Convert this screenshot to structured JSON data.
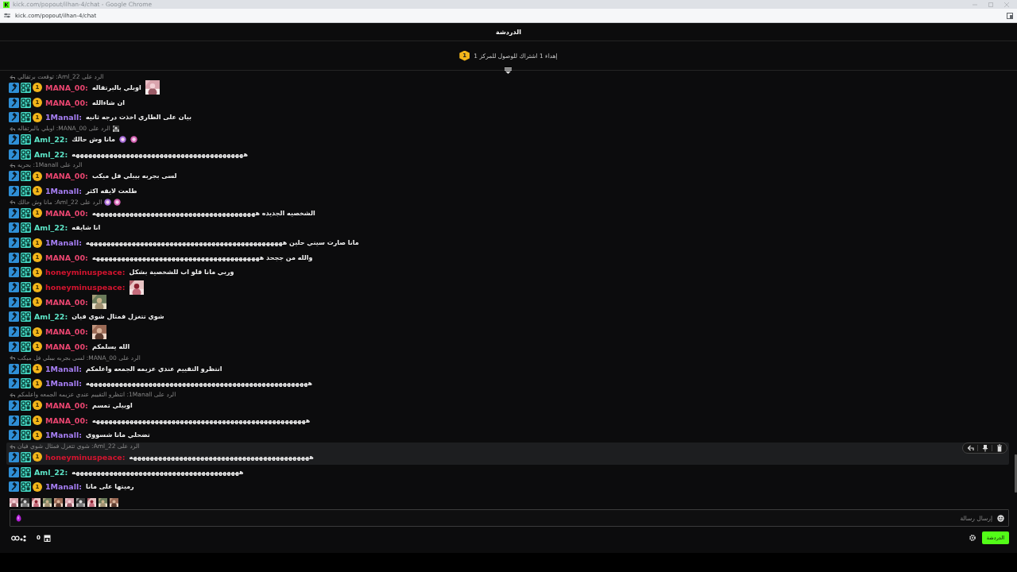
{
  "browser": {
    "title": "kick.com/popout/ilhan-4/chat - Google Chrome",
    "url": "kick.com/popout/ilhan-4/chat"
  },
  "chat": {
    "title": "الدردشة",
    "pinned": {
      "badge": "1",
      "text": "إهداء 1 اشتراك للوصول للمركز 1"
    },
    "messages": [
      {
        "reply": {
          "text": "الرد على Aml_22: توقعت برتقالي"
        },
        "user": "MANA_00:",
        "color": "#e8456f",
        "sub_badge": "1",
        "text": "اوبلي بالبرتقاله",
        "highlighted": false
      },
      {
        "user": "MANA_00:",
        "color": "#e8456f",
        "sub_badge": "1",
        "text": "ان شاءالله",
        "highlighted": false
      },
      {
        "user": "1Manall:",
        "color": "#a77ff5",
        "sub_badge": "1",
        "text": "بيان على الطاري اخذت درجه ثانيه",
        "highlighted": false
      },
      {
        "reply": {
          "text": "الرد على MANA_00: اوبلي بالبرتقاله"
        },
        "user": "Aml_22:",
        "color": "#5de3c6",
        "text": "مانا وش حالك",
        "emojis": [
          {
            "kind": "emoji"
          },
          {
            "kind": "emoji"
          }
        ],
        "highlighted": false
      },
      {
        "user": "Aml_22:",
        "color": "#5de3c6",
        "text": "هههههههههههههههههههههههههههههههههههههههههه",
        "highlighted": false
      },
      {
        "reply": {
          "text": "الرد على 1Manall: بحريه"
        },
        "user": "MANA_00:",
        "color": "#e8456f",
        "sub_badge": "1",
        "text": "لسى بجربه بيبلي فل ميكب",
        "highlighted": false
      },
      {
        "user": "1Manall:",
        "color": "#a77ff5",
        "sub_badge": "1",
        "text": "طلعت لايقه اكثر",
        "highlighted": false
      },
      {
        "reply": {
          "text": "الرد على Aml_22: مانا وش حالك",
          "emojis": [
            {
              "kind": "emoji"
            },
            {
              "kind": "emoji"
            }
          ]
        },
        "user": "MANA_00:",
        "color": "#e8456f",
        "sub_badge": "1",
        "text": "الشخصيه الجديده هههههههههههههههههههههههههههههههههههههههه",
        "highlighted": false
      },
      {
        "user": "Aml_22:",
        "color": "#5de3c6",
        "text": "انا شايفه",
        "highlighted": false
      },
      {
        "user": "1Manall:",
        "color": "#a77ff5",
        "sub_badge": "1",
        "text": "مانا صارت سيني حلين هههههههههههههههههههههههههههههههههههههههههههههههه",
        "highlighted": false
      },
      {
        "user": "MANA_00:",
        "color": "#e8456f",
        "sub_badge": "1",
        "text": "والله من ججحد ههههههههههههههههههههههههههههههههههههههههه",
        "highlighted": false
      },
      {
        "user": "honeyminuspeace:",
        "color": "#d4142f",
        "sub_badge": "1",
        "text": "وربي مانا قلو اب للشخصية بشكل",
        "highlighted": false
      },
      {
        "user": "honeyminuspeace:",
        "color": "#d4142f",
        "sub_badge": "1",
        "highlighted": false
      },
      {
        "user": "MANA_00:",
        "color": "#e8456f",
        "sub_badge": "1",
        "highlighted": false
      },
      {
        "user": "Aml_22:",
        "color": "#5de3c6",
        "text": "شوي تتغزل فمثال شوي فيان",
        "highlighted": false
      },
      {
        "user": "MANA_00:",
        "color": "#e8456f",
        "sub_badge": "1",
        "highlighted": false
      },
      {
        "user": "MANA_00:",
        "color": "#e8456f",
        "sub_badge": "1",
        "text": "الله يسلمكم",
        "highlighted": false
      },
      {
        "reply": {
          "text": "الرد على MANA_00: لسى بجربه بيبلي فل ميكب"
        },
        "user": "1Manall:",
        "color": "#a77ff5",
        "sub_badge": "1",
        "text": "انتظرو التقييم عندي عزيمه الجمعه واعلمكم",
        "highlighted": false
      },
      {
        "user": "1Manall:",
        "color": "#a77ff5",
        "sub_badge": "1",
        "text": "هههههههههههههههههههههههههههههههههههههههههههههههههههههه",
        "highlighted": false
      },
      {
        "reply": {
          "text": "الرد على 1Manall: انتظرو التقييم عندي عزيمه الجمعه واعلمكم"
        },
        "user": "MANA_00:",
        "color": "#e8456f",
        "sub_badge": "1",
        "text": "اوبيلي تمسم",
        "highlighted": false
      },
      {
        "user": "MANA_00:",
        "color": "#e8456f",
        "sub_badge": "1",
        "text": "هههههههههههههههههههههههههههههههههههههههههههههههههههه",
        "highlighted": false
      },
      {
        "user": "1Manall:",
        "color": "#a77ff5",
        "sub_badge": "1",
        "text": "تضحلي مانا شسووي",
        "highlighted": false
      },
      {
        "reply": {
          "text": "الرد على Aml_22: شوي تتغزل فمثال شوي فيان"
        },
        "user": "honeyminuspeace:",
        "color": "#d4142f",
        "sub_badge": "1",
        "text": "هههههههههههههههههههههههههههههههههههههههههههه",
        "highlighted": true
      },
      {
        "user": "Aml_22:",
        "color": "#5de3c6",
        "text": "ههههههههههههههههههههههههههههههههههههههههه",
        "highlighted": false
      },
      {
        "user": "1Manall:",
        "color": "#a77ff5",
        "sub_badge": "1",
        "text": "رميتها على مانا",
        "highlighted": false
      }
    ],
    "message_actions": [
      {
        "kind": "reply"
      },
      {
        "kind": "pin"
      },
      {
        "kind": "delete"
      }
    ],
    "input": {
      "placeholder": "إرسال رسالة"
    },
    "footer": {
      "count": "0",
      "chat_button": "الدردشة"
    }
  }
}
